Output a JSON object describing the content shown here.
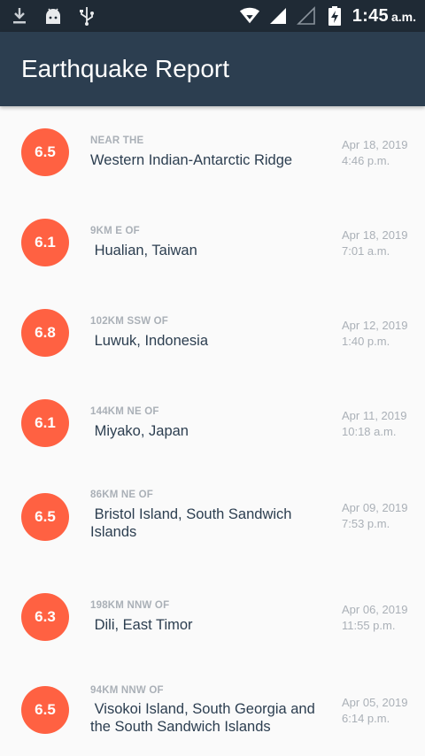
{
  "status_bar": {
    "time": "1:45",
    "ampm": "a.m.",
    "icons": [
      "download-icon",
      "android-icon",
      "usb-icon",
      "wifi-icon",
      "signal-icon",
      "signal-empty-icon",
      "battery-charging-icon"
    ]
  },
  "app_bar": {
    "title": "Earthquake Report"
  },
  "colors": {
    "accent": "#ff6142",
    "app_bar": "#2c3e50",
    "status_bar": "#1f2a35"
  },
  "earthquakes": [
    {
      "mag": "6.5",
      "offset": "NEAR THE",
      "place": "Western Indian-Antarctic Ridge",
      "date": "Apr 18, 2019",
      "time": "4:46 p.m."
    },
    {
      "mag": "6.1",
      "offset": "9KM E OF",
      "place": " Hualian, Taiwan",
      "date": "Apr 18, 2019",
      "time": "7:01 a.m."
    },
    {
      "mag": "6.8",
      "offset": "102KM SSW OF",
      "place": " Luwuk, Indonesia",
      "date": "Apr 12, 2019",
      "time": "1:40 p.m."
    },
    {
      "mag": "6.1",
      "offset": "144KM NE OF",
      "place": " Miyako, Japan",
      "date": "Apr 11, 2019",
      "time": "10:18 a.m."
    },
    {
      "mag": "6.5",
      "offset": "86KM NE OF",
      "place": " Bristol Island, South Sandwich Islands",
      "date": "Apr 09, 2019",
      "time": "7:53 p.m."
    },
    {
      "mag": "6.3",
      "offset": "198KM NNW OF",
      "place": " Dili, East Timor",
      "date": "Apr 06, 2019",
      "time": "11:55 p.m."
    },
    {
      "mag": "6.5",
      "offset": "94KM NNW OF",
      "place": " Visokoi Island, South Georgia and the South Sandwich Islands",
      "date": "Apr 05, 2019",
      "time": "6:14 p.m."
    }
  ]
}
